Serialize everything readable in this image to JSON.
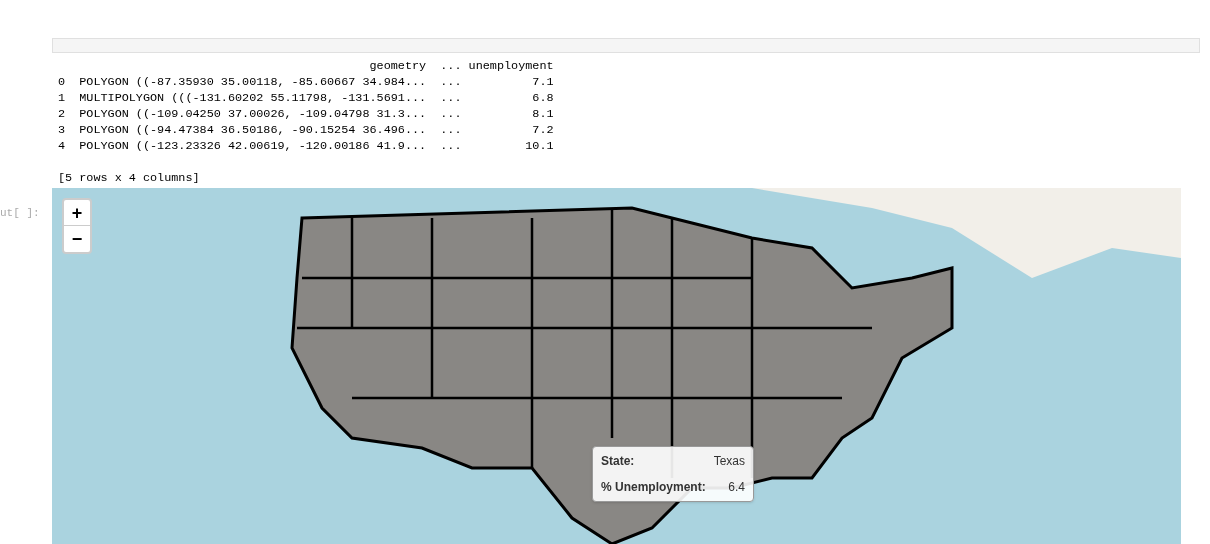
{
  "output_text": {
    "lines": [
      "                                            geometry  ... unemployment",
      "0  POLYGON ((-87.35930 35.00118, -85.60667 34.984...  ...          7.1",
      "1  MULTIPOLYGON (((-131.60202 55.11798, -131.5691...  ...          6.8",
      "2  POLYGON ((-109.04250 37.00026, -109.04798 31.3...  ...          8.1",
      "3  POLYGON ((-94.47384 36.50186, -90.15254 36.496...  ...          7.2",
      "4  POLYGON ((-123.23326 42.00619, -120.00186 41.9...  ...         10.1",
      "[5 rows x 4 columns]"
    ]
  },
  "out_prompt": "ut[ ]:",
  "map": {
    "zoom_in": "+",
    "zoom_out": "−",
    "tooltip": [
      {
        "label": "State:",
        "value": "Texas"
      },
      {
        "label": "% Unemployment:",
        "value": "6.4"
      }
    ]
  }
}
